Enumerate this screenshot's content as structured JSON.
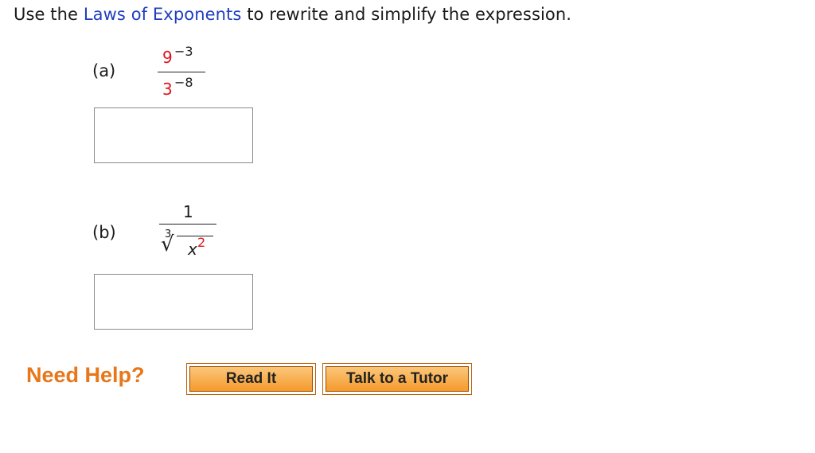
{
  "instruction": {
    "prefix": "Use the ",
    "link": "Laws of Exponents",
    "suffix": " to rewrite and simplify the expression."
  },
  "part_a": {
    "label": "(a)",
    "numerator_base": "9",
    "numerator_exponent": "−3",
    "denominator_base": "3",
    "denominator_exponent": "−8",
    "answer_value": ""
  },
  "part_b": {
    "label": "(b)",
    "numerator": "1",
    "root_index": "3",
    "radical_symbol": "√",
    "radicand_base": "x",
    "radicand_exponent": "2",
    "answer_value": ""
  },
  "help": {
    "heading": "Need Help?",
    "read_it_label": "Read It",
    "tutor_label": "Talk to a Tutor"
  },
  "colors": {
    "link": "#1f3fbf",
    "highlight_red": "#e0141c",
    "help_orange": "#e8761a",
    "button_gradient_top": "#fbc77a",
    "button_gradient_bottom": "#f49a2c"
  }
}
